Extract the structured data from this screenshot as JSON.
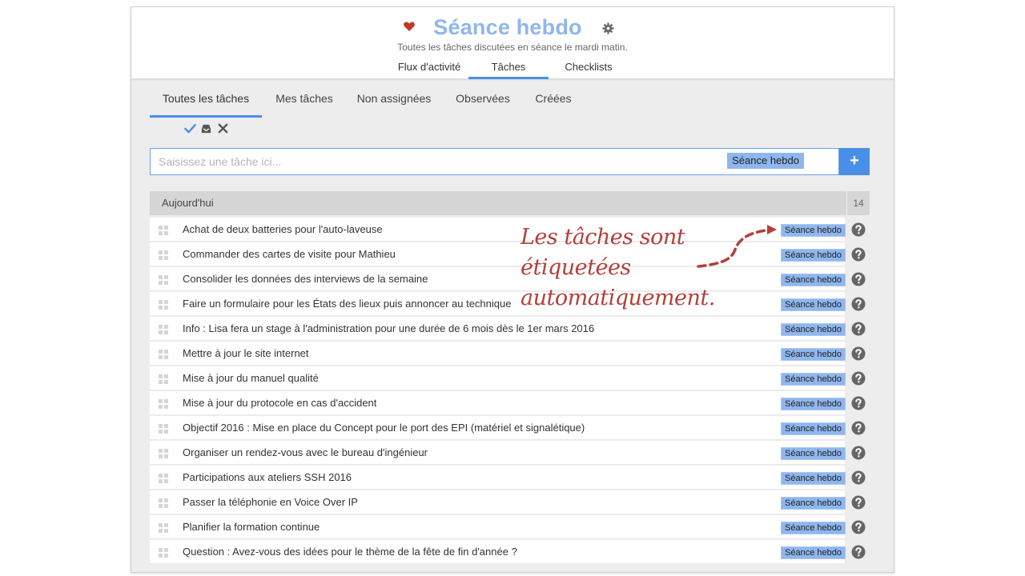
{
  "header": {
    "title": "Séance hebdo",
    "subtitle": "Toutes les tâches discutées en séance le mardi matin.",
    "tabs": [
      {
        "label": "Flux d'activité",
        "active": false
      },
      {
        "label": "Tâches",
        "active": true
      },
      {
        "label": "Checklists",
        "active": false
      }
    ]
  },
  "subtabs": [
    {
      "label": "Toutes les tâches",
      "active": true
    },
    {
      "label": "Mes tâches",
      "active": false
    },
    {
      "label": "Non assignées",
      "active": false
    },
    {
      "label": "Observées",
      "active": false
    },
    {
      "label": "Créées",
      "active": false
    }
  ],
  "filters": {
    "icons": [
      "check-icon",
      "inbox-icon",
      "close-icon"
    ]
  },
  "input": {
    "placeholder": "Saisissez une tâche ici...",
    "value": "",
    "tag": "Séance hebdo",
    "add_label": "+"
  },
  "group": {
    "title": "Aujourd'hui",
    "count": "14"
  },
  "tasks": [
    {
      "text": "Achat de deux batteries pour l'auto-laveuse",
      "tag": "Séance hebdo"
    },
    {
      "text": "Commander des cartes de visite pour Mathieu",
      "tag": "Séance hebdo"
    },
    {
      "text": "Consolider les données des interviews de la semaine",
      "tag": "Séance hebdo"
    },
    {
      "text": "Faire un formulaire pour les États des lieux puis annoncer au technique",
      "tag": "Séance hebdo"
    },
    {
      "text": "Info : Lisa fera un stage à l'administration pour une durée de 6 mois dès le 1er mars 2016",
      "tag": "Séance hebdo"
    },
    {
      "text": "Mettre à jour le site internet",
      "tag": "Séance hebdo"
    },
    {
      "text": "Mise à jour du manuel qualité",
      "tag": "Séance hebdo"
    },
    {
      "text": "Mise à jour du protocole en cas d'accident",
      "tag": "Séance hebdo"
    },
    {
      "text": "Objectif 2016 : Mise en place du Concept pour le port des EPI (matériel et signalétique)",
      "tag": "Séance hebdo"
    },
    {
      "text": "Organiser un rendez-vous avec le bureau d'ingénieur",
      "tag": "Séance hebdo"
    },
    {
      "text": "Participations aux ateliers SSH 2016",
      "tag": "Séance hebdo"
    },
    {
      "text": "Passer la téléphonie en Voice Over IP",
      "tag": "Séance hebdo"
    },
    {
      "text": "Planifier la formation continue",
      "tag": "Séance hebdo"
    },
    {
      "text": "Question : Avez-vous des idées pour le thème de la fête de fin d'année ?",
      "tag": "Séance hebdo"
    }
  ],
  "annotation": {
    "lines": [
      "Les tâches sont",
      "étiquetées",
      "automatiquement."
    ]
  },
  "colors": {
    "accent": "#4a8fe7",
    "title": "#8fb6ee",
    "tag": "#8fb6ee",
    "heart": "#c0392b",
    "annotation": "#b3403a"
  }
}
